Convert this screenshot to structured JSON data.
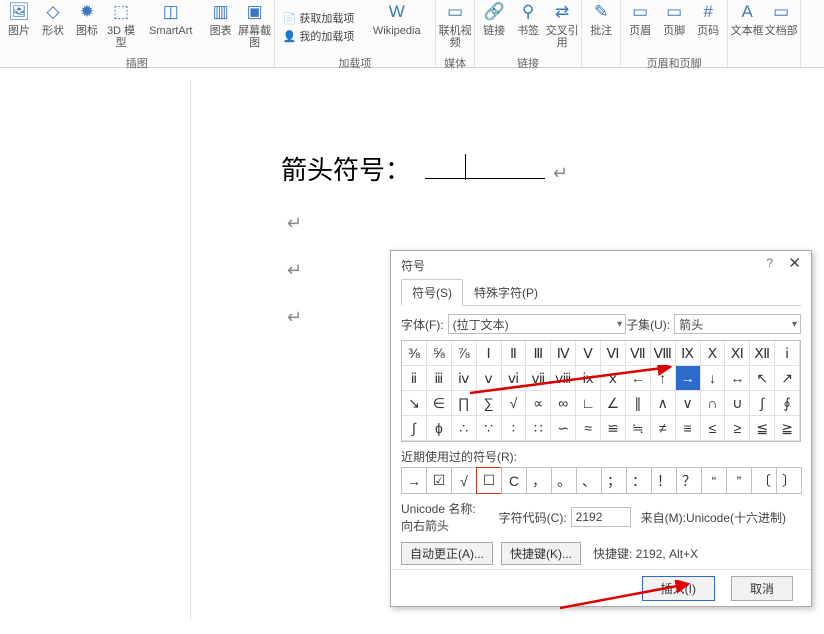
{
  "ribbon": {
    "groups": [
      {
        "label": "插图",
        "items": [
          {
            "name": "pic",
            "icon": "🖼",
            "label": "图片"
          },
          {
            "name": "shape",
            "icon": "◇",
            "label": "形状"
          },
          {
            "name": "iconbtn",
            "icon": "✹",
            "label": "图标"
          },
          {
            "name": "model3d",
            "icon": "⬚",
            "label": "3D\n模型"
          },
          {
            "name": "smartart",
            "icon": "◫",
            "label": "SmartArt"
          },
          {
            "name": "chart",
            "icon": "▥",
            "label": "图表"
          },
          {
            "name": "screenshot",
            "icon": "▣",
            "label": "屏幕截图"
          }
        ]
      },
      {
        "label": "加载项",
        "small": [
          "📄 获取加载项",
          "👤 我的加载项"
        ],
        "items": [
          {
            "name": "wikipedia",
            "icon": "W",
            "label": "Wikipedia"
          }
        ]
      },
      {
        "label": "媒体",
        "items": [
          {
            "name": "onlinevideo",
            "icon": "▭",
            "label": "联机视频"
          }
        ]
      },
      {
        "label": "链接",
        "items": [
          {
            "name": "link",
            "icon": "🔗",
            "label": "链接"
          },
          {
            "name": "bookmark",
            "icon": "⚲",
            "label": "书签"
          },
          {
            "name": "crossref",
            "icon": "⇄",
            "label": "交叉引用"
          }
        ]
      },
      {
        "label": "",
        "items": [
          {
            "name": "comment",
            "icon": "✎",
            "label": "批注"
          }
        ]
      },
      {
        "label": "页眉和页脚",
        "items": [
          {
            "name": "header",
            "icon": "▭",
            "label": "页眉"
          },
          {
            "name": "footer",
            "icon": "▭",
            "label": "页脚"
          },
          {
            "name": "pagenum",
            "icon": "#",
            "label": "页码"
          }
        ]
      },
      {
        "label": "",
        "items": [
          {
            "name": "textbox",
            "icon": "A",
            "label": "文本框"
          },
          {
            "name": "wordparts",
            "icon": "▭",
            "label": "文档部"
          }
        ]
      }
    ]
  },
  "doc": {
    "heading": "箭头符号："
  },
  "dialog": {
    "title": "符号",
    "tabs": {
      "symbol": "符号(S)",
      "special": "特殊字符(P)"
    },
    "font_label": "字体(F):",
    "font_value": "(拉丁文本)",
    "subset_label": "子集(U):",
    "subset_value": "箭头",
    "grid": [
      "⅜",
      "⅝",
      "⅞",
      "Ⅰ",
      "Ⅱ",
      "Ⅲ",
      "Ⅳ",
      "Ⅴ",
      "Ⅵ",
      "Ⅶ",
      "Ⅷ",
      "Ⅸ",
      "Ⅹ",
      "Ⅺ",
      "Ⅻ",
      "ⅰ",
      "ⅱ",
      "ⅲ",
      "ⅳ",
      "ⅴ",
      "ⅵ",
      "ⅶ",
      "ⅷ",
      "ⅸ",
      "ⅹ",
      "←",
      "↑",
      "→",
      "↓",
      "↔",
      "↖",
      "↗",
      "↘",
      "∈",
      "∏",
      "∑",
      "√",
      "∝",
      "∞",
      "∟",
      "∠",
      "∥",
      "∧",
      "∨",
      "∩",
      "∪",
      "∫",
      "∮",
      "∫",
      "ɸ",
      "∴",
      "∵",
      "∶",
      "∷",
      "∽",
      "≈",
      "≌",
      "≒",
      "≠",
      "≡",
      "≤",
      "≥",
      "≦",
      "≧"
    ],
    "selected_index": 27,
    "recent_label": "近期使用过的符号(R):",
    "recent": [
      "→",
      "☑",
      "√",
      "☐",
      "C",
      "，",
      "。",
      "、",
      "；",
      "：",
      "！",
      "？",
      "“",
      "”",
      "〔",
      "〕"
    ],
    "uniname_label": "Unicode 名称:",
    "uniname_value": "向右箭头",
    "code_label": "字符代码(C):",
    "code_value": "2192",
    "from_label": "来自(M):",
    "from_value": "Unicode(十六进制)",
    "autocorrect": "自动更正(A)...",
    "shortcutkey": "快捷键(K)...",
    "shortcut_text": "快捷键: 2192, Alt+X",
    "insert": "插入(I)",
    "cancel": "取消"
  }
}
